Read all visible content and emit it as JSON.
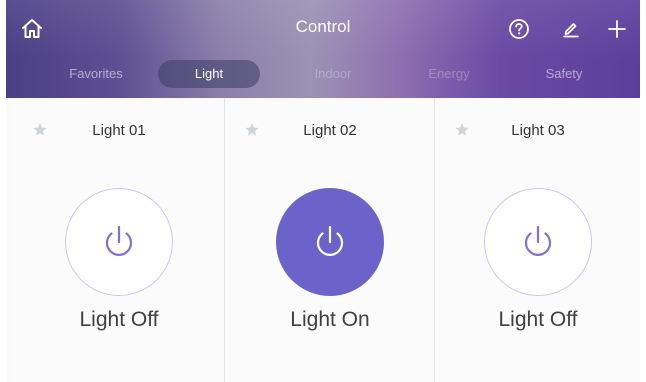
{
  "header": {
    "title": "Control",
    "tabs": [
      {
        "label": "Favorites",
        "state": "mid"
      },
      {
        "label": "Light",
        "state": "active"
      },
      {
        "label": "Indoor",
        "state": "dim"
      },
      {
        "label": "Energy",
        "state": "dim"
      },
      {
        "label": "Safety",
        "state": "mid"
      }
    ],
    "icons": [
      "home-icon",
      "help-icon",
      "edit-icon",
      "add-icon"
    ]
  },
  "devices": [
    {
      "name": "Light 01",
      "status": "Light Off",
      "on": false
    },
    {
      "name": "Light 02",
      "status": "Light On",
      "on": true
    },
    {
      "name": "Light 03",
      "status": "Light Off",
      "on": false
    }
  ],
  "colors": {
    "accent": "#6b63c9",
    "ring": "#cdc8ee",
    "star": "#cfd3da"
  }
}
